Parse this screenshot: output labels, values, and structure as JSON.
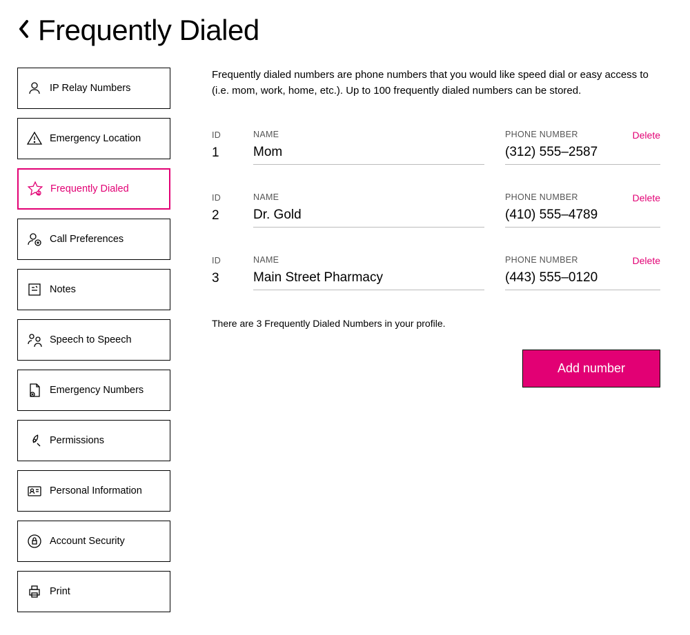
{
  "header": {
    "title": "Frequently Dialed"
  },
  "sidebar": {
    "items": [
      {
        "label": "IP Relay Numbers"
      },
      {
        "label": "Emergency Location"
      },
      {
        "label": "Frequently Dialed"
      },
      {
        "label": "Call Preferences"
      },
      {
        "label": "Notes"
      },
      {
        "label": "Speech to Speech"
      },
      {
        "label": "Emergency Numbers"
      },
      {
        "label": "Permissions"
      },
      {
        "label": "Personal Information"
      },
      {
        "label": "Account Security"
      },
      {
        "label": "Print"
      }
    ]
  },
  "main": {
    "description": "Frequently dialed numbers are phone numbers that you would like speed dial or easy access to (i.e. mom, work, home, etc.). Up to 100 frequently dialed numbers can be stored.",
    "labels": {
      "id": "ID",
      "name": "NAME",
      "phone": "PHONE NUMBER",
      "delete": "Delete"
    },
    "entries": [
      {
        "id": "1",
        "name": "Mom",
        "phone": "(312) 555–2587"
      },
      {
        "id": "2",
        "name": "Dr. Gold",
        "phone": "(410) 555–4789"
      },
      {
        "id": "3",
        "name": "Main Street Pharmacy",
        "phone": "(443) 555–0120"
      }
    ],
    "summary": "There are 3 Frequently Dialed Numbers in your profile.",
    "add_button": "Add number"
  }
}
